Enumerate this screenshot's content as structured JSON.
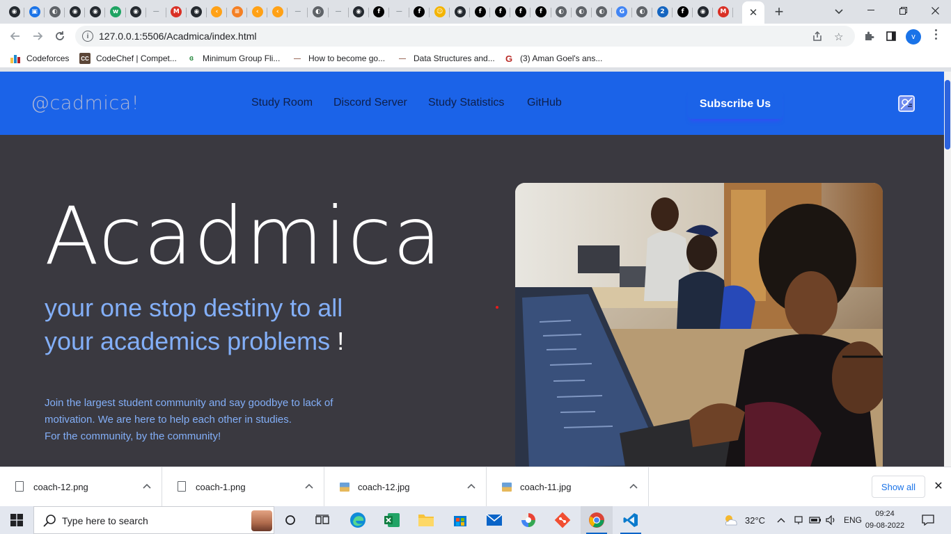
{
  "browser": {
    "tab_favicons": [
      {
        "icon": "github-icon",
        "color": "#24292f",
        "glyph": "◉"
      },
      {
        "icon": "blue-square-icon",
        "color": "#1a73e8",
        "glyph": "▣"
      },
      {
        "icon": "globe-icon",
        "color": "#5f6368",
        "glyph": "◐"
      },
      {
        "icon": "github-icon",
        "color": "#24292f",
        "glyph": "◉"
      },
      {
        "icon": "github-icon",
        "color": "#24292f",
        "glyph": "◉"
      },
      {
        "icon": "w-icon",
        "color": "#1fa463",
        "glyph": "w"
      },
      {
        "icon": "github-icon",
        "color": "#24292f",
        "glyph": "◉"
      },
      {
        "icon": "dash-icon",
        "color": "#9aa0a6",
        "glyph": "—"
      },
      {
        "icon": "gmail-icon",
        "color": "#d93025",
        "glyph": "M"
      },
      {
        "icon": "github-icon",
        "color": "#24292f",
        "glyph": "◉"
      },
      {
        "icon": "leetcode-icon",
        "color": "#ffa116",
        "glyph": "‹"
      },
      {
        "icon": "stackoverflow-icon",
        "color": "#f48024",
        "glyph": "≡"
      },
      {
        "icon": "leetcode-icon",
        "color": "#ffa116",
        "glyph": "‹"
      },
      {
        "icon": "leetcode-icon",
        "color": "#ffa116",
        "glyph": "‹"
      },
      {
        "icon": "dash-icon",
        "color": "#9aa0a6",
        "glyph": "—"
      },
      {
        "icon": "globe-icon",
        "color": "#5f6368",
        "glyph": "◐"
      },
      {
        "icon": "dash-icon",
        "color": "#9aa0a6",
        "glyph": "—"
      },
      {
        "icon": "github-icon",
        "color": "#24292f",
        "glyph": "◉"
      },
      {
        "icon": "black-circle-icon",
        "color": "#000000",
        "glyph": "f"
      },
      {
        "icon": "dash-icon",
        "color": "#9aa0a6",
        "glyph": "—"
      },
      {
        "icon": "black-circle-icon",
        "color": "#000000",
        "glyph": "f"
      },
      {
        "icon": "emoji-icon",
        "color": "#f4b400",
        "glyph": "☺"
      },
      {
        "icon": "github-icon",
        "color": "#24292f",
        "glyph": "◉"
      },
      {
        "icon": "black-circle-icon",
        "color": "#000000",
        "glyph": "f"
      },
      {
        "icon": "black-circle-icon",
        "color": "#000000",
        "glyph": "f"
      },
      {
        "icon": "black-circle-icon",
        "color": "#000000",
        "glyph": "f"
      },
      {
        "icon": "black-circle-icon",
        "color": "#000000",
        "glyph": "f"
      },
      {
        "icon": "globe-icon",
        "color": "#5f6368",
        "glyph": "◐"
      },
      {
        "icon": "globe-icon",
        "color": "#5f6368",
        "glyph": "◐"
      },
      {
        "icon": "globe-icon",
        "color": "#5f6368",
        "glyph": "◐"
      },
      {
        "icon": "google-icon",
        "color": "#4285f4",
        "glyph": "G"
      },
      {
        "icon": "globe-icon",
        "color": "#5f6368",
        "glyph": "◐"
      },
      {
        "icon": "number-two-icon",
        "color": "#1565c0",
        "glyph": "2"
      },
      {
        "icon": "black-circle-icon",
        "color": "#000000",
        "glyph": "f"
      },
      {
        "icon": "github-icon",
        "color": "#24292f",
        "glyph": "◉"
      },
      {
        "icon": "gmail-icon",
        "color": "#d93025",
        "glyph": "M"
      }
    ],
    "active_tab_close": "✕",
    "new_tab": "+",
    "url": "127.0.0.1:5506/Acadmica/index.html",
    "profile_initial": "v",
    "bookmarks": [
      {
        "label": "Codeforces",
        "icon": "codeforces-icon"
      },
      {
        "label": "CodeChef | Compet...",
        "icon": "codechef-icon"
      },
      {
        "label": "Minimum Group Fli...",
        "icon": "geeksforgeeks-icon"
      },
      {
        "label": "How to become go...",
        "icon": "dash-icon"
      },
      {
        "label": "Data Structures and...",
        "icon": "dash-icon"
      },
      {
        "label": "(3) Aman Goel's ans...",
        "icon": "quora-icon"
      }
    ]
  },
  "site": {
    "logo": "@cadmica!",
    "nav": [
      "Study Room",
      "Discord Server",
      "Study Statistics",
      "GitHub"
    ],
    "subscribe": "Subscribe Us",
    "hero_title": "Acadmica",
    "hero_subtitle": "your one stop destiny to all your academics problems",
    "hero_subtitle_end": "!",
    "hero_desc_1": "Join the largest student community and say goodbye to lack of motivation. We are here to help each other in studies.",
    "hero_desc_2": "For the community, by the community!",
    "colors": {
      "nav_bg": "#1b63e8",
      "page_bg": "#3a3940",
      "accent_text": "#83aff8"
    }
  },
  "downloads": {
    "items": [
      {
        "name": "coach-12.png",
        "kind": "file"
      },
      {
        "name": "coach-1.png",
        "kind": "file"
      },
      {
        "name": "coach-12.jpg",
        "kind": "image"
      },
      {
        "name": "coach-11.jpg",
        "kind": "image"
      }
    ],
    "show_all": "Show all"
  },
  "taskbar": {
    "search_placeholder": "Type here to search",
    "weather": "32°C",
    "language": "ENG",
    "time": "09:24",
    "date": "09-08-2022"
  }
}
